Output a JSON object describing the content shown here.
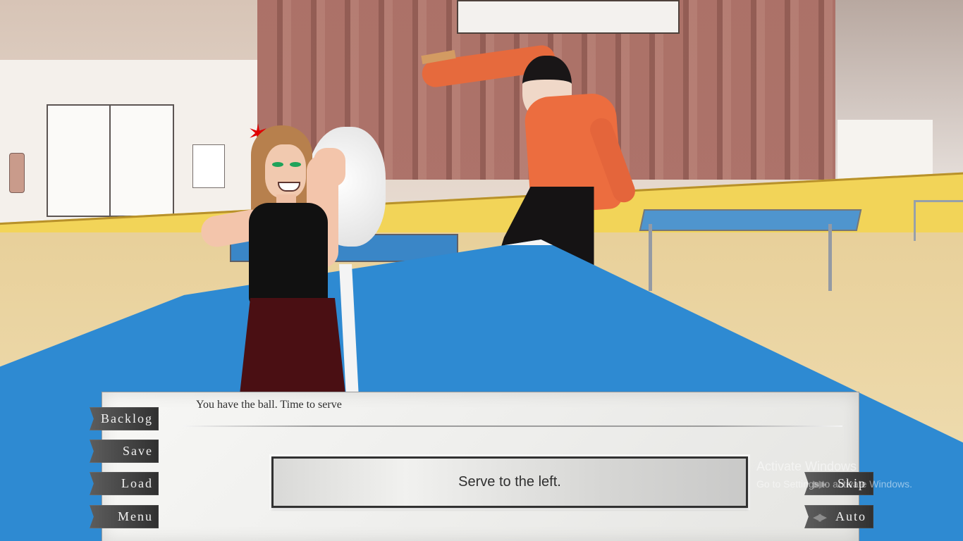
{
  "dialog": {
    "text": "You have the ball. Time to serve",
    "choice": "Serve to the left."
  },
  "menu": {
    "backlog": "Backlog",
    "save": "Save",
    "load": "Load",
    "menu": "Menu"
  },
  "controls": {
    "skip": "Skip",
    "auto": "Auto"
  },
  "watermark": {
    "title": "Activate Windows",
    "subtitle": "Go to Settings to activate Windows."
  },
  "icons": {
    "anger": "anger-vein-icon",
    "skip": "fast-forward-icon",
    "auto": "play-icon"
  }
}
